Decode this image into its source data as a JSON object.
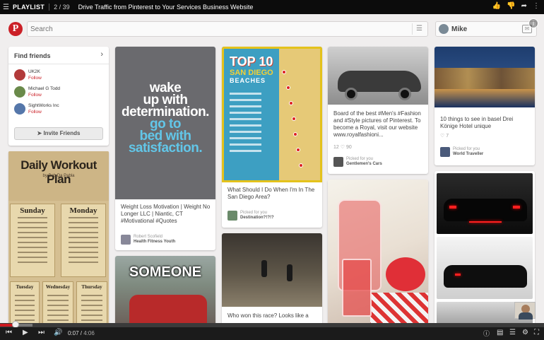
{
  "playlist": {
    "label": "PLAYLIST",
    "position": "2 / 39",
    "title": "Drive Traffic from Pinterest to Your Services Business Website"
  },
  "pinterest": {
    "logo_letter": "P",
    "search_placeholder": "Search",
    "user_name": "Mike"
  },
  "find_friends": {
    "title": "Find friends",
    "friends": [
      {
        "name": "UK2K",
        "action": "Follow"
      },
      {
        "name": "Michael G Todd",
        "action": "Follow"
      },
      {
        "name": "SightWorks Inc",
        "action": "Follow"
      }
    ],
    "invite_label": "Invite Friends"
  },
  "workout": {
    "title": "Daily Workout Plan",
    "subtitle": "by Bob Da Pabla",
    "days": [
      "Sunday",
      "Monday",
      "Tuesday",
      "Wednesday",
      "Thursday"
    ]
  },
  "pins": {
    "motivation": {
      "image_lines": [
        "wake",
        "up with",
        "determination.",
        "go to",
        "bed with",
        "satisfaction."
      ],
      "description": "Weight Loss Motivation | Weight No Longer LLC | Niantic, CT #Motivational #Quotes",
      "pinner": "Robert Scofield",
      "board": "Health Fitness Youth"
    },
    "someone": {
      "image_text": "SOMEONE"
    },
    "san_diego": {
      "image_top": "TOP 10",
      "image_city": "SAN DIEGO",
      "image_beaches": "BEACHES",
      "description": "What Should I Do When I'm In The San Diego Area?",
      "pinned_for": "Picked for you",
      "board": "Destination?!?!?"
    },
    "race": {
      "description": "Who won this race? Looks like a"
    },
    "car": {
      "description": "Board of the best #Men's #Fashion and #Style pictures of Pinterest. To become a Royal, visit our website www.royalfashioni...",
      "meta": "12 ♡ 90",
      "pinned_for": "Picked for you",
      "board": "Gentlemen's Cars"
    },
    "basel": {
      "description": "10 things to see in basel Drei Könige Hotel unique",
      "meta": "♡ 7",
      "pinned_for": "Picked for you",
      "board": "World Traveller"
    }
  },
  "player": {
    "current_time": "0:07",
    "duration": "4:06",
    "progress_fraction": 0.028,
    "loaded_fraction": 0.06
  },
  "colors": {
    "pinterest_red": "#cb2027",
    "progress_red": "#cc181e"
  }
}
